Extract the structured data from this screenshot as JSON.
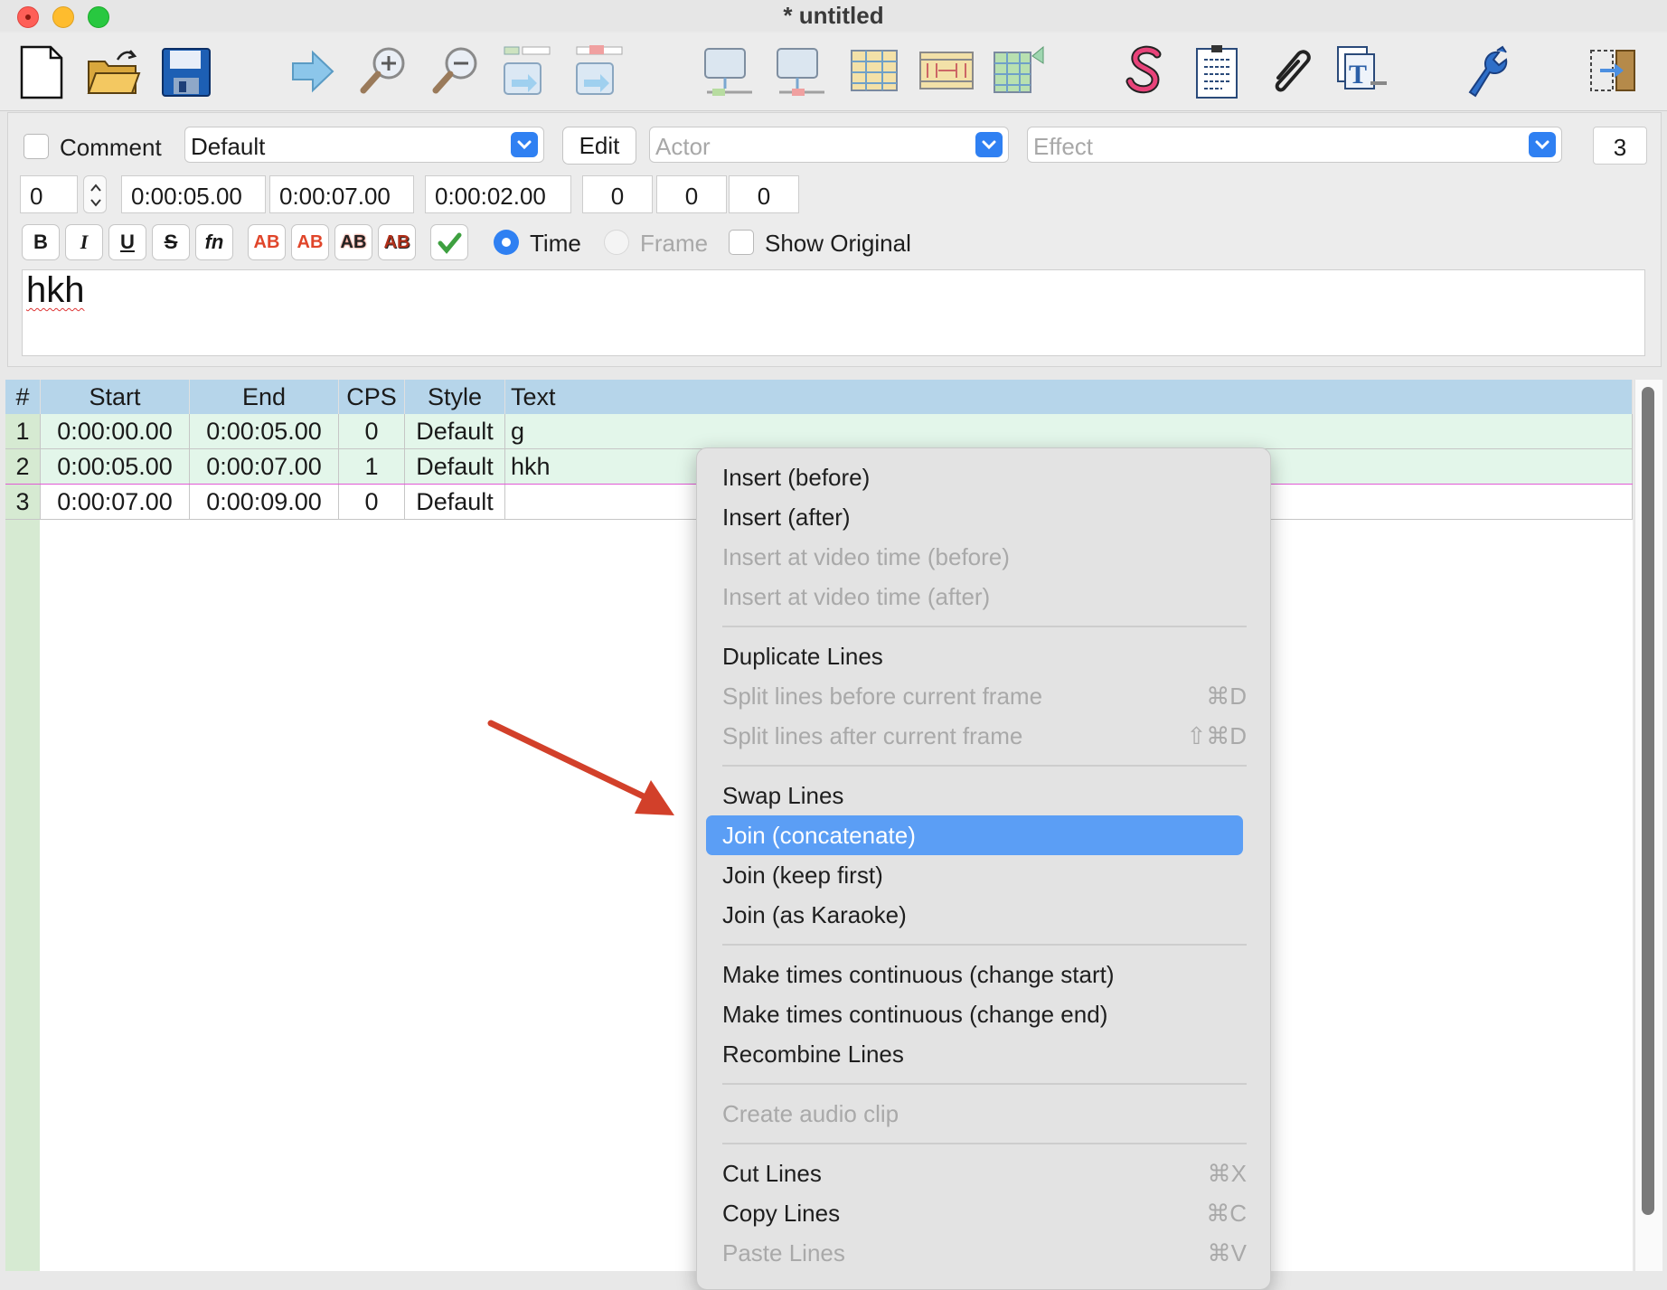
{
  "window": {
    "title": "* untitled"
  },
  "toolbar": {
    "icons": [
      "new-file-icon",
      "open-folder-icon",
      "save-icon",
      "jump-arrow-icon",
      "zoom-in-icon",
      "zoom-out-icon",
      "snap-start-icon",
      "snap-end-icon",
      "video-frame-before-icon",
      "video-frame-after-icon",
      "grid-table-icon",
      "film-strip-icon",
      "timing-grid-icon",
      "styles-s-icon",
      "notes-icon",
      "paperclip-icon",
      "translate-icon",
      "automation-gear-icon",
      "exit-icon"
    ]
  },
  "editor": {
    "comment_label": "Comment",
    "style_value": "Default",
    "edit_label": "Edit",
    "actor_placeholder": "Actor",
    "effect_placeholder": "Effect",
    "line_count": "3",
    "layer": "0",
    "start_time": "0:00:05.00",
    "end_time": "0:00:07.00",
    "duration": "0:00:02.00",
    "margin_l": "0",
    "margin_r": "0",
    "margin_v": "0",
    "format_buttons": [
      "B",
      "I",
      "U",
      "S",
      "fn",
      "AB",
      "AB",
      "AB",
      "AB"
    ],
    "time_label": "Time",
    "frame_label": "Frame",
    "show_original_label": "Show Original",
    "text": "hkh"
  },
  "grid": {
    "headers": [
      "#",
      "Start",
      "End",
      "CPS",
      "Style",
      "Text"
    ],
    "rows": [
      {
        "num": "1",
        "start": "0:00:00.00",
        "end": "0:00:05.00",
        "cps": "0",
        "style": "Default",
        "text": "g"
      },
      {
        "num": "2",
        "start": "0:00:05.00",
        "end": "0:00:07.00",
        "cps": "1",
        "style": "Default",
        "text": "hkh"
      },
      {
        "num": "3",
        "start": "0:00:07.00",
        "end": "0:00:09.00",
        "cps": "0",
        "style": "Default",
        "text": ""
      }
    ]
  },
  "context_menu": {
    "insert_before": "Insert (before)",
    "insert_after": "Insert (after)",
    "insert_video_before": "Insert at video time (before)",
    "insert_video_after": "Insert at video time (after)",
    "duplicate": "Duplicate Lines",
    "split_before": "Split lines before current frame",
    "split_before_sc": "⌘D",
    "split_after": "Split lines after current frame",
    "split_after_sc": "⇧⌘D",
    "swap": "Swap Lines",
    "join_concat": "Join (concatenate)",
    "join_keep": "Join (keep first)",
    "join_karaoke": "Join (as Karaoke)",
    "continuous_start": "Make times continuous (change start)",
    "continuous_end": "Make times continuous (change end)",
    "recombine": "Recombine Lines",
    "audio_clip": "Create audio clip",
    "cut": "Cut Lines",
    "cut_sc": "⌘X",
    "copy": "Copy Lines",
    "copy_sc": "⌘C",
    "paste": "Paste Lines",
    "paste_sc": "⌘V"
  },
  "colors": {
    "accent": "#2f80f2",
    "highlight": "#5b9ef5",
    "annotation_arrow": "#d2402a",
    "grid_header": "#b6d5ea",
    "row_bg": "#e3f6ea"
  }
}
